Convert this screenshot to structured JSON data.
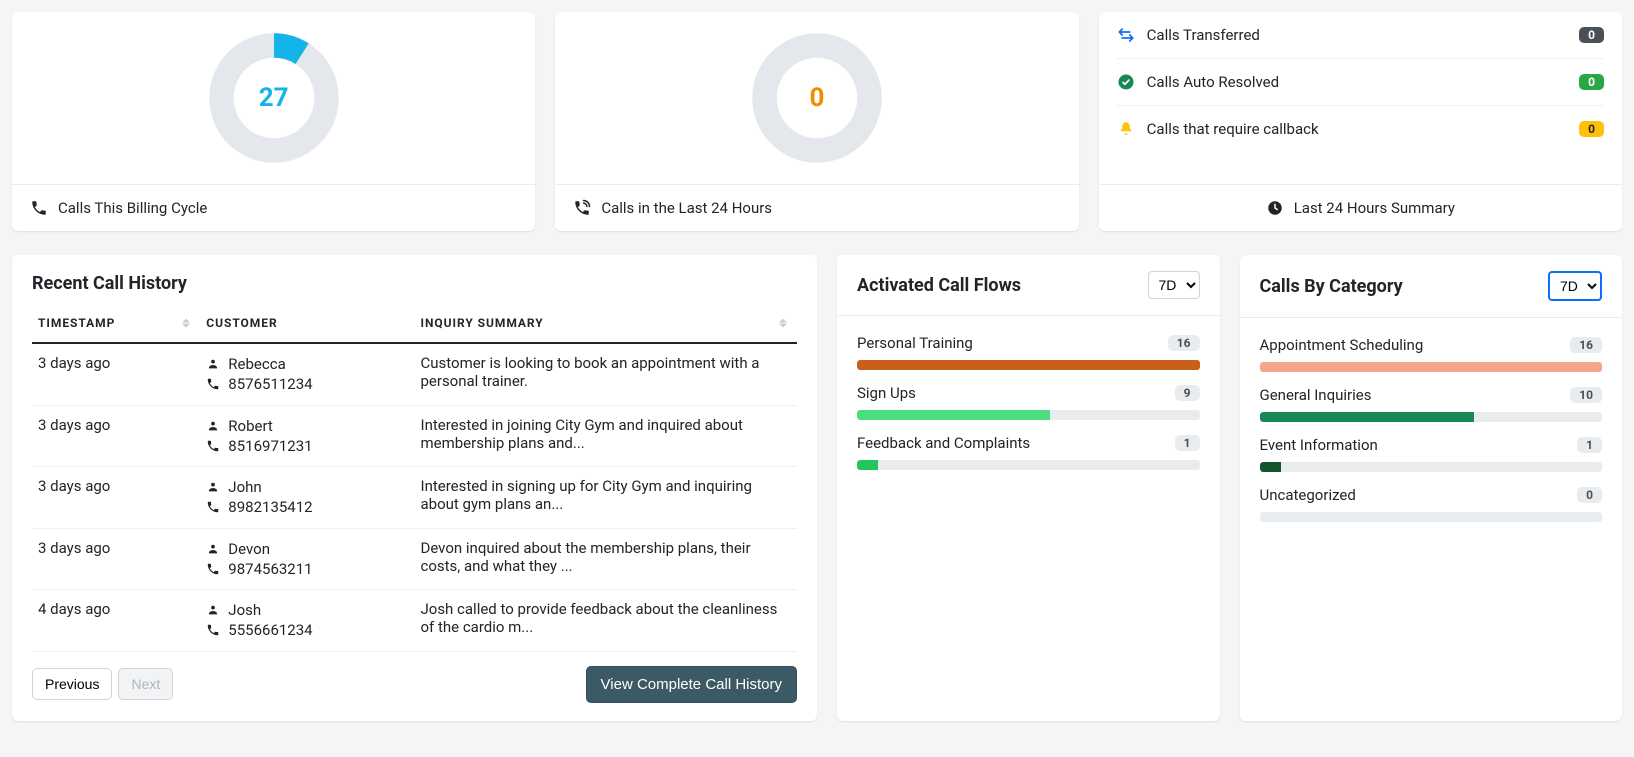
{
  "topCards": {
    "billing": {
      "value": 27,
      "percent": 9,
      "color": "#14b4e8",
      "footerIcon": "phone-icon",
      "footerLabel": "Calls This Billing Cycle"
    },
    "last24": {
      "value": 0,
      "percent": 0,
      "color": "#f08c00",
      "footerIcon": "phone-volume-icon",
      "footerLabel": "Calls in the Last 24 Hours"
    },
    "summary": {
      "footerIcon": "clock-icon",
      "footerLabel": "Last 24 Hours Summary",
      "rows": [
        {
          "icon": "transfer-icon",
          "iconColor": "#0d6efd",
          "label": "Calls Transferred",
          "count": 0,
          "badgeClass": "badge-dark"
        },
        {
          "icon": "check-circle-icon",
          "iconColor": "#198754",
          "label": "Calls Auto Resolved",
          "count": 0,
          "badgeClass": "badge-green"
        },
        {
          "icon": "bell-icon",
          "iconColor": "#ffc107",
          "label": "Calls that require callback",
          "count": 0,
          "badgeClass": "badge-amber"
        }
      ]
    }
  },
  "history": {
    "title": "Recent Call History",
    "columns": {
      "timestamp": "TIMESTAMP",
      "customer": "CUSTOMER",
      "inquiry": "INQUIRY SUMMARY"
    },
    "rows": [
      {
        "time": "3 days ago",
        "name": "Rebecca",
        "phone": "8576511234",
        "summary": "Customer is looking to book an appointment with a personal trainer."
      },
      {
        "time": "3 days ago",
        "name": "Robert",
        "phone": "8516971231",
        "summary": "Interested in joining City Gym and inquired about membership plans and..."
      },
      {
        "time": "3 days ago",
        "name": "John",
        "phone": "8982135412",
        "summary": "Interested in signing up for City Gym and inquiring about gym plans an..."
      },
      {
        "time": "3 days ago",
        "name": "Devon",
        "phone": "9874563211",
        "summary": "Devon inquired about the membership plans, their costs, and what they ..."
      },
      {
        "time": "4 days ago",
        "name": "Josh",
        "phone": "5556661234",
        "summary": "Josh called to provide feedback about the cleanliness of the cardio m..."
      }
    ],
    "pager": {
      "prev": "Previous",
      "next": "Next"
    },
    "viewAll": "View Complete Call History"
  },
  "flows": {
    "title": "Activated Call Flows",
    "range": "7D",
    "rangeOptions": [
      "7D"
    ],
    "max": 16,
    "items": [
      {
        "label": "Personal Training",
        "count": 16,
        "color": "#c8601a"
      },
      {
        "label": "Sign Ups",
        "count": 9,
        "color": "#4ade80"
      },
      {
        "label": "Feedback and Complaints",
        "count": 1,
        "color": "#22c55e"
      }
    ]
  },
  "categories": {
    "title": "Calls By Category",
    "range": "7D",
    "rangeOptions": [
      "7D"
    ],
    "max": 16,
    "items": [
      {
        "label": "Appointment Scheduling",
        "count": 16,
        "color": "#f4a58a"
      },
      {
        "label": "General Inquiries",
        "count": 10,
        "color": "#198754"
      },
      {
        "label": "Event Information",
        "count": 1,
        "color": "#14532d"
      },
      {
        "label": "Uncategorized",
        "count": 0,
        "color": "#adb5bd"
      }
    ]
  },
  "colors": {
    "donutTrack": "#e4e7eb"
  }
}
